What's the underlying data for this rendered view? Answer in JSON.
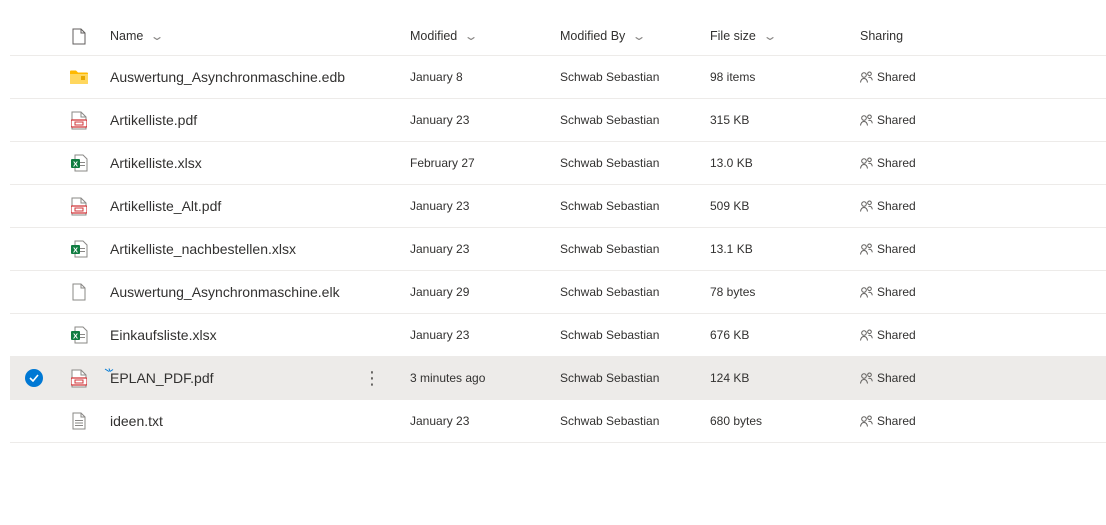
{
  "columns": {
    "name": "Name",
    "modified": "Modified",
    "modified_by": "Modified By",
    "file_size": "File size",
    "sharing": "Sharing"
  },
  "rows": [
    {
      "icon": "folder-icon",
      "name": "Auswertung_Asynchronmaschine.edb",
      "modified": "January 8",
      "modified_by": "Schwab Sebastian",
      "size": "98 items",
      "sharing": "Shared"
    },
    {
      "icon": "pdf-file-icon",
      "name": "Artikelliste.pdf",
      "modified": "January 23",
      "modified_by": "Schwab Sebastian",
      "size": "315 KB",
      "sharing": "Shared"
    },
    {
      "icon": "excel-file-icon",
      "name": "Artikelliste.xlsx",
      "modified": "February 27",
      "modified_by": "Schwab Sebastian",
      "size": "13.0 KB",
      "sharing": "Shared"
    },
    {
      "icon": "pdf-file-icon",
      "name": "Artikelliste_Alt.pdf",
      "modified": "January 23",
      "modified_by": "Schwab Sebastian",
      "size": "509 KB",
      "sharing": "Shared"
    },
    {
      "icon": "excel-file-icon",
      "name": "Artikelliste_nachbestellen.xlsx",
      "modified": "January 23",
      "modified_by": "Schwab Sebastian",
      "size": "13.1 KB",
      "sharing": "Shared"
    },
    {
      "icon": "generic-file-icon",
      "name": "Auswertung_Asynchronmaschine.elk",
      "modified": "January 29",
      "modified_by": "Schwab Sebastian",
      "size": "78 bytes",
      "sharing": "Shared"
    },
    {
      "icon": "excel-file-icon",
      "name": "Einkaufsliste.xlsx",
      "modified": "January 23",
      "modified_by": "Schwab Sebastian",
      "size": "676 KB",
      "sharing": "Shared"
    },
    {
      "icon": "pdf-file-icon",
      "name": "EPLAN_PDF.pdf",
      "modified": "3 minutes ago",
      "modified_by": "Schwab Sebastian",
      "size": "124 KB",
      "sharing": "Shared",
      "selected": true,
      "new": true
    },
    {
      "icon": "text-file-icon",
      "name": "ideen.txt",
      "modified": "January 23",
      "modified_by": "Schwab Sebastian",
      "size": "680 bytes",
      "sharing": "Shared"
    }
  ],
  "colors": {
    "accent": "#0078d4",
    "selected_row": "#edebe9",
    "excel_green": "#107c41",
    "pdf_red": "#d13438",
    "folder_yellow": "#ffb900"
  }
}
